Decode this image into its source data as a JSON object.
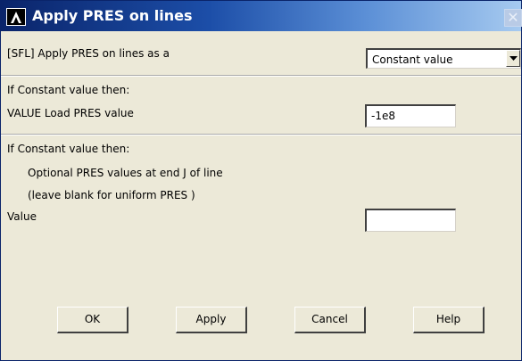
{
  "window": {
    "title": "Apply PRES on lines",
    "close_glyph": "✕",
    "logo_icon": "ansys-logo-icon"
  },
  "section1": {
    "label": "[SFL] Apply PRES on lines as a",
    "dropdown_value": "Constant value"
  },
  "section2": {
    "header": "If Constant value then:",
    "label": "VALUE  Load PRES value",
    "value": "-1e8"
  },
  "section3": {
    "header": "If Constant value then:",
    "line1": "Optional PRES values at end J of line",
    "line2": "(leave blank for uniform PRES )",
    "label": "Value",
    "value": ""
  },
  "buttons": {
    "ok": "OK",
    "apply": "Apply",
    "cancel": "Cancel",
    "help": "Help"
  },
  "colors": {
    "titlebar_start": "#0a246a",
    "titlebar_end": "#a6caf0",
    "dialog_bg": "#ece9d8"
  }
}
